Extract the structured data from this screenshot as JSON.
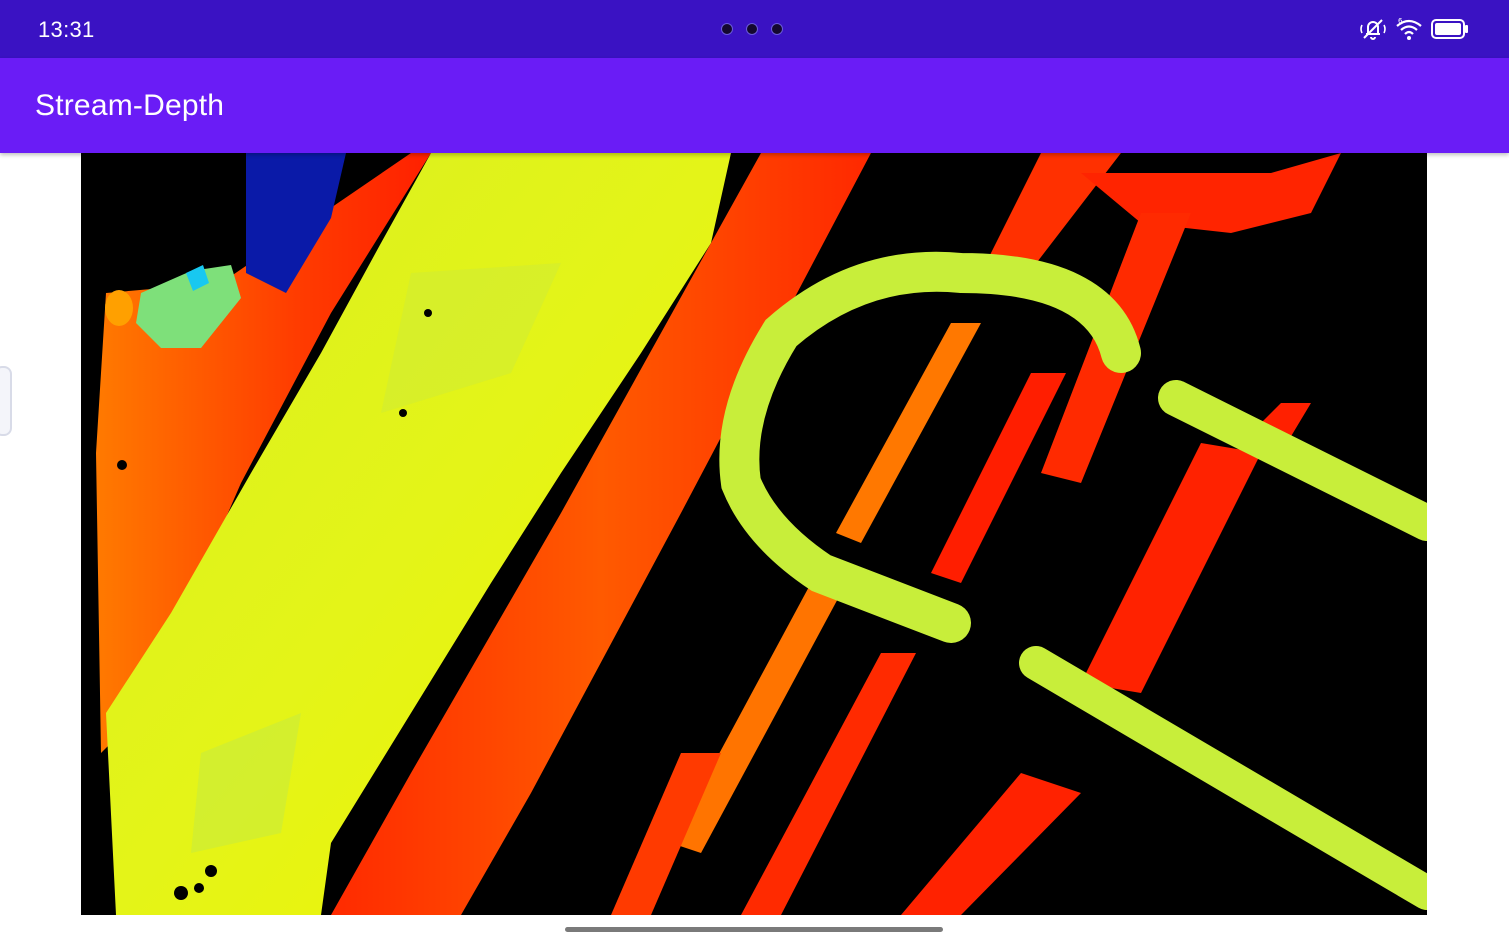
{
  "status_bar": {
    "time": "13:31",
    "background_color": "#3a12c3",
    "icons": [
      "do-not-disturb-icon",
      "wifi-icon",
      "battery-icon"
    ]
  },
  "app_bar": {
    "title": "Stream-Depth",
    "background_color": "#6a1cf6"
  },
  "depth_stream": {
    "colormap": "jet",
    "background_color": "#000000"
  }
}
